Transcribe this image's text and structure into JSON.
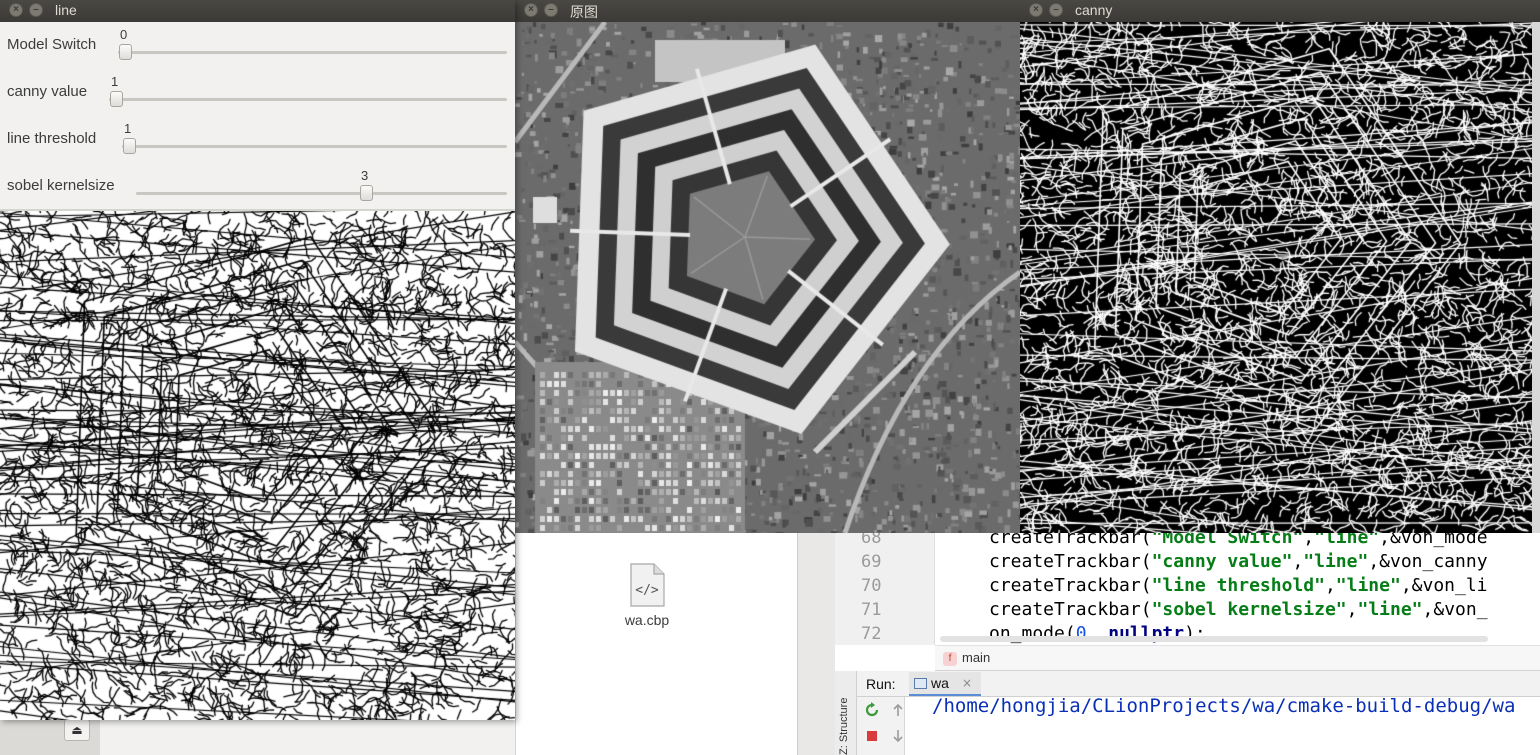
{
  "windows": {
    "line": {
      "title": "line"
    },
    "original": {
      "title": "原图"
    },
    "canny": {
      "title": "canny"
    }
  },
  "trackbars": [
    {
      "label": "Model Switch",
      "value": "0",
      "fraction": 0.0
    },
    {
      "label": "canny value",
      "value": "1",
      "fraction": 0.0
    },
    {
      "label": "line threshold",
      "value": "1",
      "fraction": 0.0
    },
    {
      "label": "sobel kernelsize",
      "value": "3",
      "fraction": 0.6
    }
  ],
  "file_manager": {
    "file_name": "wa.cbp",
    "file_icon": "xml-file-icon"
  },
  "ide": {
    "code_lines": [
      {
        "num": "68",
        "parts": [
          [
            "plain",
            "createTrackbar("
          ],
          [
            "str",
            "\"Model Switch\""
          ],
          [
            "plain",
            ","
          ],
          [
            "str",
            "\"line\""
          ],
          [
            "plain",
            ",&von_mode"
          ]
        ]
      },
      {
        "num": "69",
        "parts": [
          [
            "plain",
            "createTrackbar("
          ],
          [
            "str",
            "\"canny value\""
          ],
          [
            "plain",
            ","
          ],
          [
            "str",
            "\"line\""
          ],
          [
            "plain",
            ",&von_canny"
          ]
        ]
      },
      {
        "num": "70",
        "parts": [
          [
            "plain",
            "createTrackbar("
          ],
          [
            "str",
            "\"line threshold\""
          ],
          [
            "plain",
            ","
          ],
          [
            "str",
            "\"line\""
          ],
          [
            "plain",
            ",&von_li"
          ]
        ]
      },
      {
        "num": "71",
        "parts": [
          [
            "plain",
            "createTrackbar("
          ],
          [
            "str",
            "\"sobel kernelsize\""
          ],
          [
            "plain",
            ","
          ],
          [
            "str",
            "\"line\""
          ],
          [
            "plain",
            ",&von_"
          ]
        ]
      },
      {
        "num": "72",
        "parts": [
          [
            "plain",
            "on_mode("
          ],
          [
            "num",
            "0"
          ],
          [
            "plain",
            ", "
          ],
          [
            "kw",
            "nullptr"
          ],
          [
            "plain",
            ");"
          ]
        ]
      }
    ],
    "breadcrumb": {
      "badge": "f",
      "text": "main"
    },
    "side_tab": "Z: Structure",
    "run": {
      "label": "Run:",
      "tab_label": "wa",
      "tab_close": "×",
      "output": "/home/hongjia/CLionProjects/wa/cmake-build-debug/wa"
    }
  },
  "colors": {
    "titlebar": "#3c3b37",
    "string": "#067d17",
    "number": "#1750eb",
    "keyword": "#000080",
    "run_output": "#0a2fb7"
  }
}
